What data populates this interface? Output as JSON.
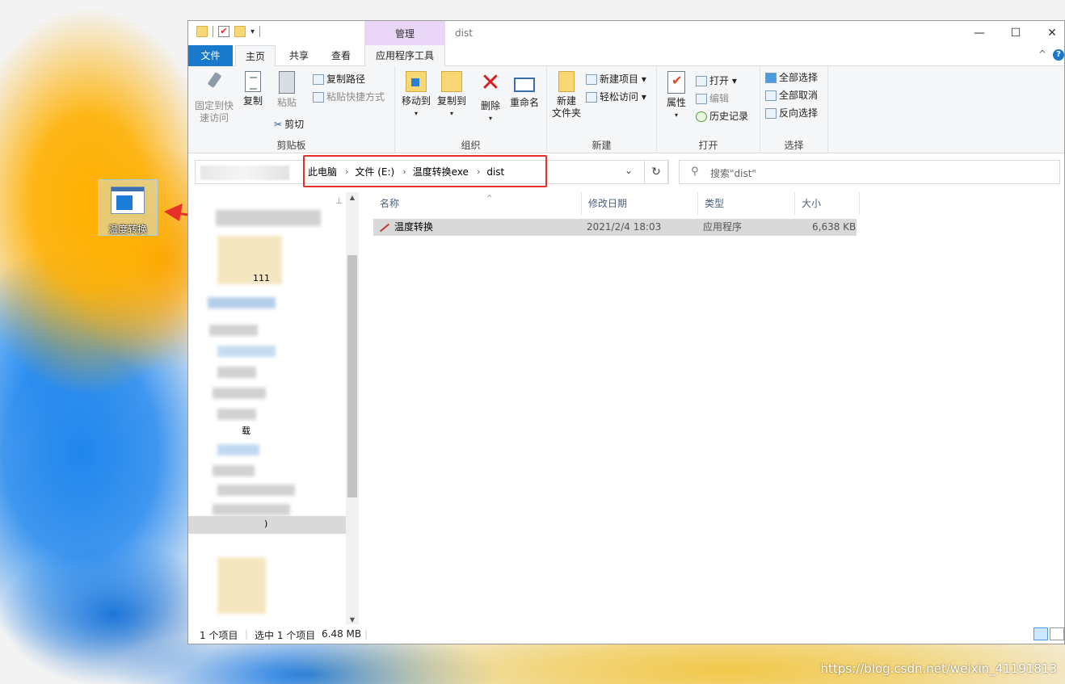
{
  "desktop": {
    "icon_label": "温度转换",
    "watermark": "https://blog.csdn.net/weixin_41191813"
  },
  "window": {
    "title": "dist",
    "contextual_tab": "管理",
    "controls": {
      "minimize": "—",
      "maximize": "☐",
      "close": "✕"
    }
  },
  "ribbon_tabs": {
    "file": "文件",
    "home": "主页",
    "share": "共享",
    "view": "查看",
    "app_tools": "应用程序工具"
  },
  "ribbon": {
    "clipboard": {
      "label": "剪贴板",
      "pin_quick_access_1": "固定到快",
      "pin_quick_access_2": "速访问",
      "copy": "复制",
      "paste": "粘贴",
      "copy_path": "复制路径",
      "paste_shortcut": "粘贴快捷方式",
      "cut": "剪切"
    },
    "organize": {
      "label": "组织",
      "move_to": "移动到",
      "copy_to": "复制到",
      "delete": "删除",
      "rename": "重命名"
    },
    "new": {
      "label": "新建",
      "new_folder_1": "新建",
      "new_folder_2": "文件夹",
      "new_item": "新建项目",
      "easy_access": "轻松访问"
    },
    "open": {
      "label": "打开",
      "properties": "属性",
      "open": "打开",
      "edit": "编辑",
      "history": "历史记录"
    },
    "select": {
      "label": "选择",
      "select_all": "全部选择",
      "select_none": "全部取消",
      "invert": "反向选择"
    }
  },
  "address": {
    "crumbs": [
      "此电脑",
      "文件 (E:)",
      "温度转换exe",
      "dist"
    ],
    "search_placeholder": "搜索\"dist\""
  },
  "nav_visible_fragments": {
    "a": "111",
    "b": "载",
    "c": ")"
  },
  "columns": {
    "name": "名称",
    "date": "修改日期",
    "type": "类型",
    "size": "大小"
  },
  "files": [
    {
      "name": "温度转换",
      "date": "2021/2/4 18:03",
      "type": "应用程序",
      "size": "6,638 KB"
    }
  ],
  "status": {
    "count": "1 个项目",
    "selected": "选中 1 个项目",
    "size": "6.48 MB"
  },
  "colors": {
    "accent": "#1979ca",
    "highlight_box": "#e8302b",
    "contextual_tab": "#e9d6f7"
  }
}
